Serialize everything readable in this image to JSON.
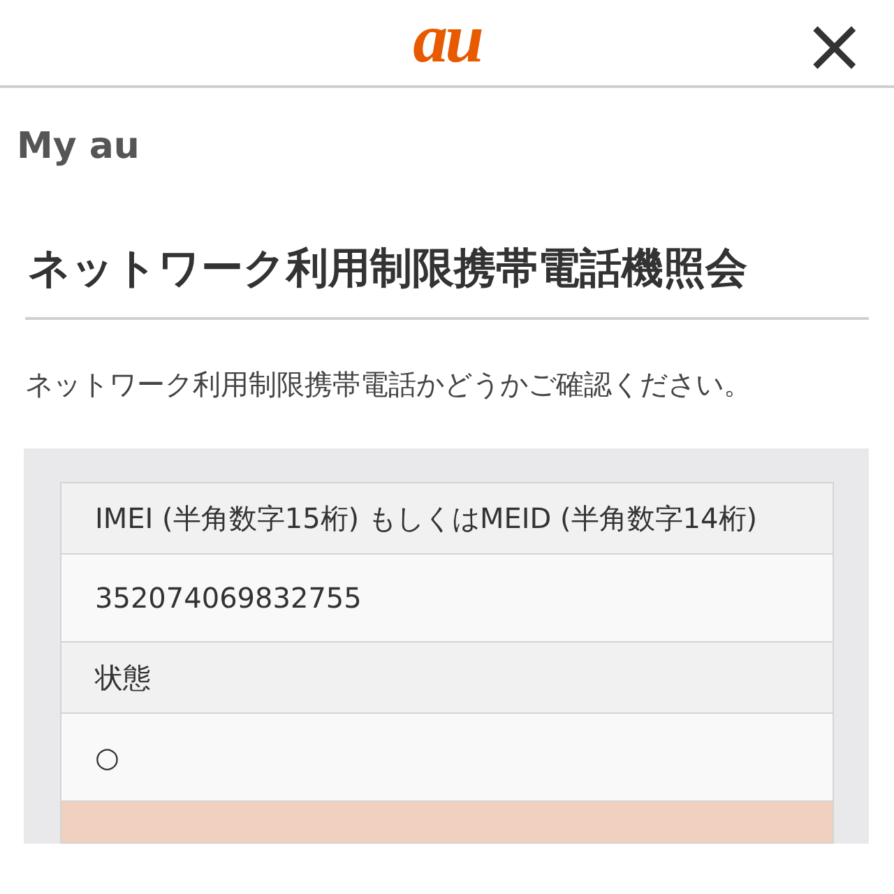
{
  "header": {
    "logo": "au",
    "close": "×"
  },
  "breadcrumb": "My au",
  "title": "ネットワーク利用制限携帯電話機照会",
  "description": "ネットワーク利用制限携帯電話かどうかご確認ください。",
  "table": {
    "rows": [
      {
        "kind": "label",
        "text": "IMEI (半角数字15桁) もしくはMEID (半角数字14桁)"
      },
      {
        "kind": "value",
        "text": "352074069832755"
      },
      {
        "kind": "label",
        "text": "状態"
      },
      {
        "kind": "value",
        "text": "○"
      },
      {
        "kind": "result"
      }
    ]
  }
}
